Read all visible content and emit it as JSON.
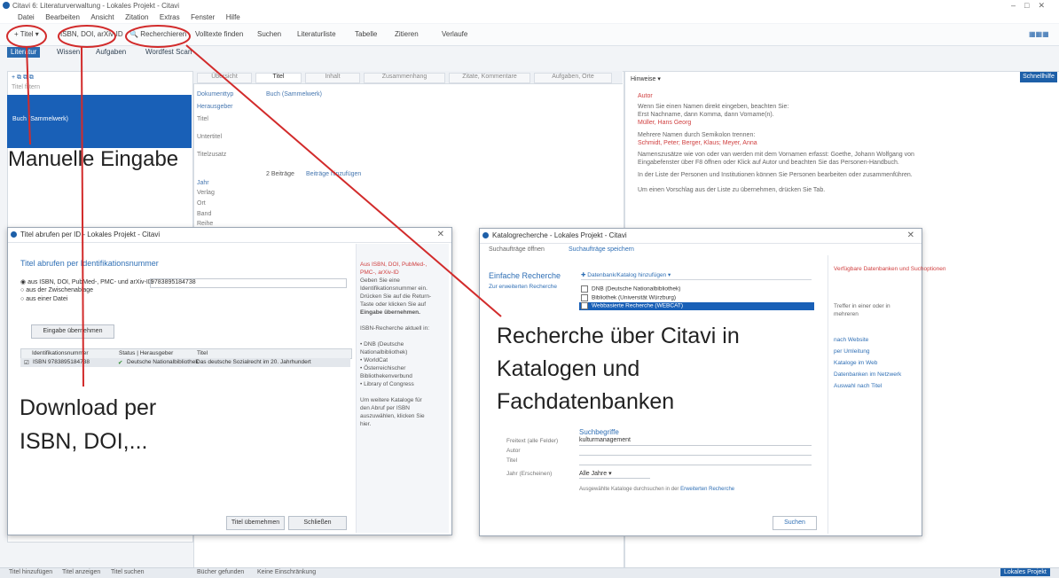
{
  "window": {
    "title": "Citavi 6: Literaturverwaltung - Lokales Projekt - Citavi"
  },
  "menubar": {
    "items": [
      "Datei",
      "Bearbeiten",
      "Ansicht",
      "Zitation",
      "Extras",
      "Fenster",
      "Hilfe"
    ]
  },
  "toolbar": {
    "titel_button": "Titel",
    "isbn_button": "ISBN, DOI, arXiv-ID",
    "recherche_button": "Recherchieren",
    "items": [
      "Volltexte finden",
      "Suchen",
      "Literaturliste",
      "Tabelle",
      "Zitieren",
      "Verlaufe"
    ]
  },
  "section_tabs": [
    "Literatur",
    "Wissen",
    "Aufgaben",
    "Wordfest Scan"
  ],
  "left_pane": {
    "filter_hint": "Titel filtern",
    "selected_item": "Buch (Sammelwerk)"
  },
  "mid_tabs": [
    "Übersicht",
    "Titel",
    "Inhalt",
    "Zusammenhang",
    "Zitate, Kommentare",
    "Aufgaben, Orte"
  ],
  "fields": {
    "labels": [
      "Dokumenttyp",
      "Herausgeber",
      "Titel",
      "Untertitel",
      "Titelzusatz",
      "Jahr",
      "Verlag",
      "Ort",
      "Band",
      "Reihe"
    ],
    "dokumenttyp_value": "Buch (Sammelwerk)",
    "extra_link": "2 Beiträge",
    "add_link": "Beiträge hinzufügen"
  },
  "right_pane": {
    "dropdown": "Hinweise",
    "button": "Schnellhilfe",
    "heading": "Autor",
    "lines": [
      "Wenn Sie einen Namen direkt eingeben, beachten Sie:",
      "Erst Nachname, dann Komma, dann Vorname(n).",
      "Müller, Hans Georg",
      "Mehrere Namen durch Semikolon trennen:",
      "Schmidt, Peter; Berger, Klaus; Meyer, Anna",
      "Namenszusätze wie von oder van werden mit dem Vornamen erfasst: Goethe, Johann Wolfgang von",
      "Eingabefenster über F8 öffnen oder Klick auf Autor und beachten Sie das Personen-Handbuch.",
      "In der Liste der Personen und Institutionen können Sie Personen bearbeiten oder zusammenführen.",
      "Um einen Vorschlag aus der Liste zu übernehmen, drücken Sie Tab."
    ]
  },
  "annotations": {
    "manual": "Manuelle Eingabe",
    "download_line1": "Download per",
    "download_line2": "ISBN, DOI,...",
    "recherche_line1": "Recherche über Citavi in",
    "recherche_line2": "Katalogen und",
    "recherche_line3": "Fachdatenbanken"
  },
  "dialog_isbn": {
    "title": "Titel abrufen per ID - Lokales Projekt - Citavi",
    "heading": "Titel abrufen per Identifikationsnummer",
    "option1": "aus ISBN, DOI, PubMed-, PMC- und arXiv-ID",
    "option1_value": "9783895184738",
    "option2": "aus der Zwischenablage",
    "option3": "aus einer Datei",
    "apply_input_button": "Eingabe übernehmen",
    "table_headers": [
      "Identifikationsnummer",
      "Status | Herausgeber",
      "Titel"
    ],
    "row": [
      "ISBN 9783895184738",
      "Deutsche Nationalbibliothek",
      "Das deutsche Sozialrecht im 20. Jahrhundert"
    ],
    "sidebar": [
      "Aus ISBN, DOI, PubMed-,",
      "PMC-, arXiv-ID",
      "Geben Sie eine",
      "Identifikationsnummer ein.",
      "Drücken Sie auf die Return-",
      "Taste oder klicken Sie auf",
      "Eingabe übernehmen.",
      "",
      "ISBN-Recherche aktuell in:",
      "",
      "• DNB (Deutsche",
      "  Nationalbibliothek)",
      "• WorldCat",
      "• Österreichischer",
      "  Bibliothekenverbund",
      "• Library of Congress",
      "",
      "Um weitere Kataloge für",
      "den Abruf per ISBN",
      "auszuwählen, klicken Sie",
      "hier."
    ],
    "take_button": "Titel übernehmen",
    "close_button": "Schließen"
  },
  "dialog_recherche": {
    "title": "Katalogrecherche - Lokales Projekt - Citavi",
    "toolbar_left": "Suchaufträge öffnen",
    "toolbar_right": "Suchaufträge speichern",
    "simple": "Einfache Recherche",
    "advanced": "Zur erweiterten Recherche",
    "databases_dropdown": "Datenbank/Katalog hinzufügen",
    "dbs": [
      "DNB (Deutsche Nationalbibliothek)",
      "Bibliothek (Universität Würzburg)",
      "Webbasierte Recherche (WEBCAT)"
    ],
    "search_terms_title": "Suchbegriffe",
    "field_labels": [
      "Freitext (alle Felder)",
      "Autor",
      "Titel",
      "Jahr (Erscheinen)"
    ],
    "freitext_value": "kulturmanagement",
    "jahr_value": "Alle Jahre",
    "hint": "Ausgewählte Kataloge durchsuchen in der",
    "hint_link": "Erweiterten Recherche",
    "search_button": "Suchen",
    "side_title": "Verfügbare Datenbanken und Suchoptionen",
    "side_lines": [
      "Treffer in einer oder in",
      "mehreren"
    ],
    "side_links": [
      "nach Website",
      "per Umleitung",
      "Kataloge im Web",
      "Datenbanken im Netzwerk",
      "Auswahl nach Titel"
    ]
  },
  "statusbar": {
    "left": [
      "Titel hinzufügen",
      "Titel anzeigen",
      "Titel suchen"
    ],
    "mid": [
      "Bücher gefunden",
      "Keine Einschränkung"
    ],
    "right_button": "Lokales Projekt"
  },
  "colors": {
    "accent": "#1d5fa8",
    "annotation": "#d22b2b",
    "selection": "#1960b7"
  }
}
